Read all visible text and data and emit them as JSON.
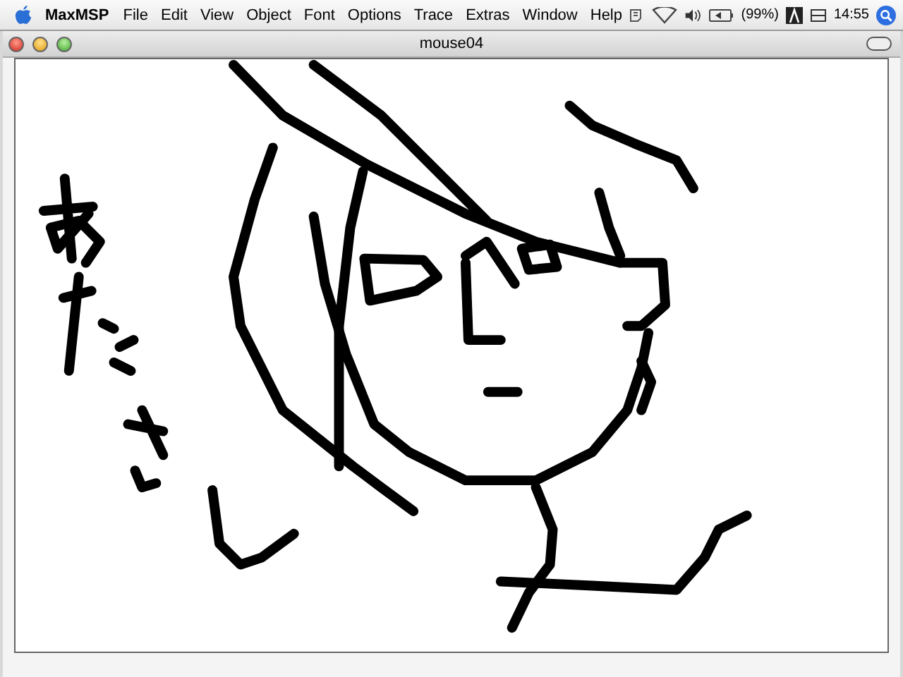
{
  "menubar": {
    "app": "MaxMSP",
    "menus": [
      "File",
      "Edit",
      "View",
      "Object",
      "Font",
      "Options",
      "Trace",
      "Extras",
      "Window",
      "Help"
    ],
    "battery": "(99%)",
    "clock": "14:55"
  },
  "window": {
    "title": "mouse04"
  }
}
